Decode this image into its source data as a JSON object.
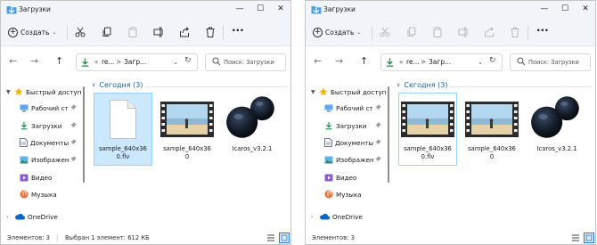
{
  "window": {
    "title": "Загрузки",
    "minimize_glyph": "—",
    "maximize_glyph": "☐",
    "close_glyph": "✕"
  },
  "toolbar": {
    "new_label": "Создать",
    "more_glyph": "···",
    "icons": [
      "cut-icon",
      "copy-icon",
      "paste-icon",
      "rename-icon",
      "share-icon",
      "delete-icon"
    ]
  },
  "navigation": {
    "back_glyph": "←",
    "forward_glyph": "→",
    "up_glyph": "↑",
    "address_overflow": "«",
    "address_parent": "re...",
    "address_separator": ">",
    "address_current": "Загр...",
    "search_placeholder": "Поиск: Загрузки"
  },
  "sidebar": {
    "items": [
      {
        "label": "Быстрый доступ",
        "icon": "star-icon",
        "pinned": false
      },
      {
        "label": "Рабочий ст",
        "icon": "desktop-icon",
        "pinned": true
      },
      {
        "label": "Загрузки",
        "icon": "download-icon",
        "pinned": true
      },
      {
        "label": "Документы",
        "icon": "documents-icon",
        "pinned": true
      },
      {
        "label": "Изображен",
        "icon": "pictures-icon",
        "pinned": true
      },
      {
        "label": "Видео",
        "icon": "video-icon",
        "pinned": false
      },
      {
        "label": "Музыка",
        "icon": "music-icon",
        "pinned": false
      },
      {
        "label": "OneDrive",
        "icon": "cloud-icon",
        "pinned": false
      }
    ]
  },
  "content": {
    "group_header": "Сегодня (3)",
    "files": [
      {
        "name": "sample_640x360.flv",
        "type": "flv"
      },
      {
        "name": "sample_640x360",
        "type": "video"
      },
      {
        "name": "Icaros_v3.2.1",
        "type": "icaros"
      }
    ]
  },
  "left_window": {
    "status_count": "Элементов: 3",
    "status_selection": "Выбран 1 элемент: 612 КБ"
  },
  "right_window": {
    "status_count": "Элементов: 3"
  },
  "colors": {
    "accent": "#1a5fb4",
    "selection": "#cce8ff",
    "selection_border": "#99d1ff",
    "chrome": "#f1f5fa"
  }
}
